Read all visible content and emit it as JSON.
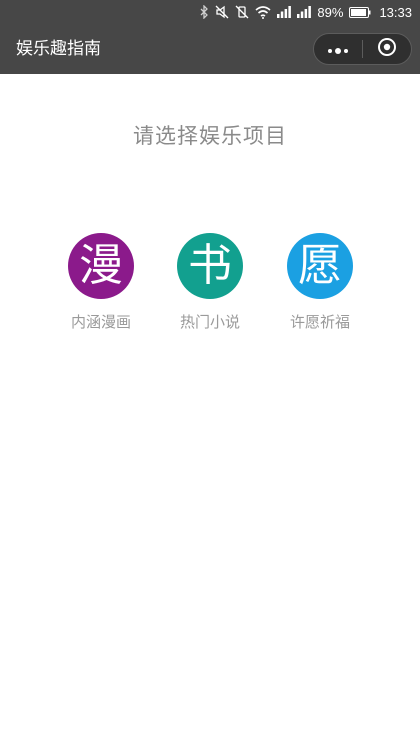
{
  "status_bar": {
    "battery_percent": "89%",
    "time": "13:33"
  },
  "nav": {
    "title": "娱乐趣指南",
    "capsule_icons": [
      "more-dots-icon",
      "close-circle-icon"
    ]
  },
  "main": {
    "prompt": "请选择娱乐项目",
    "options": [
      {
        "glyph": "漫",
        "label": "内涵漫画",
        "color": "#8b1a8b"
      },
      {
        "glyph": "书",
        "label": "热门小说",
        "color": "#12a08f"
      },
      {
        "glyph": "愿",
        "label": "许愿祈福",
        "color": "#1ba0e2"
      }
    ]
  },
  "colors": {
    "bar_background": "#474747",
    "prompt_text": "#8a8a8a",
    "label_text": "#9a9a9a"
  }
}
